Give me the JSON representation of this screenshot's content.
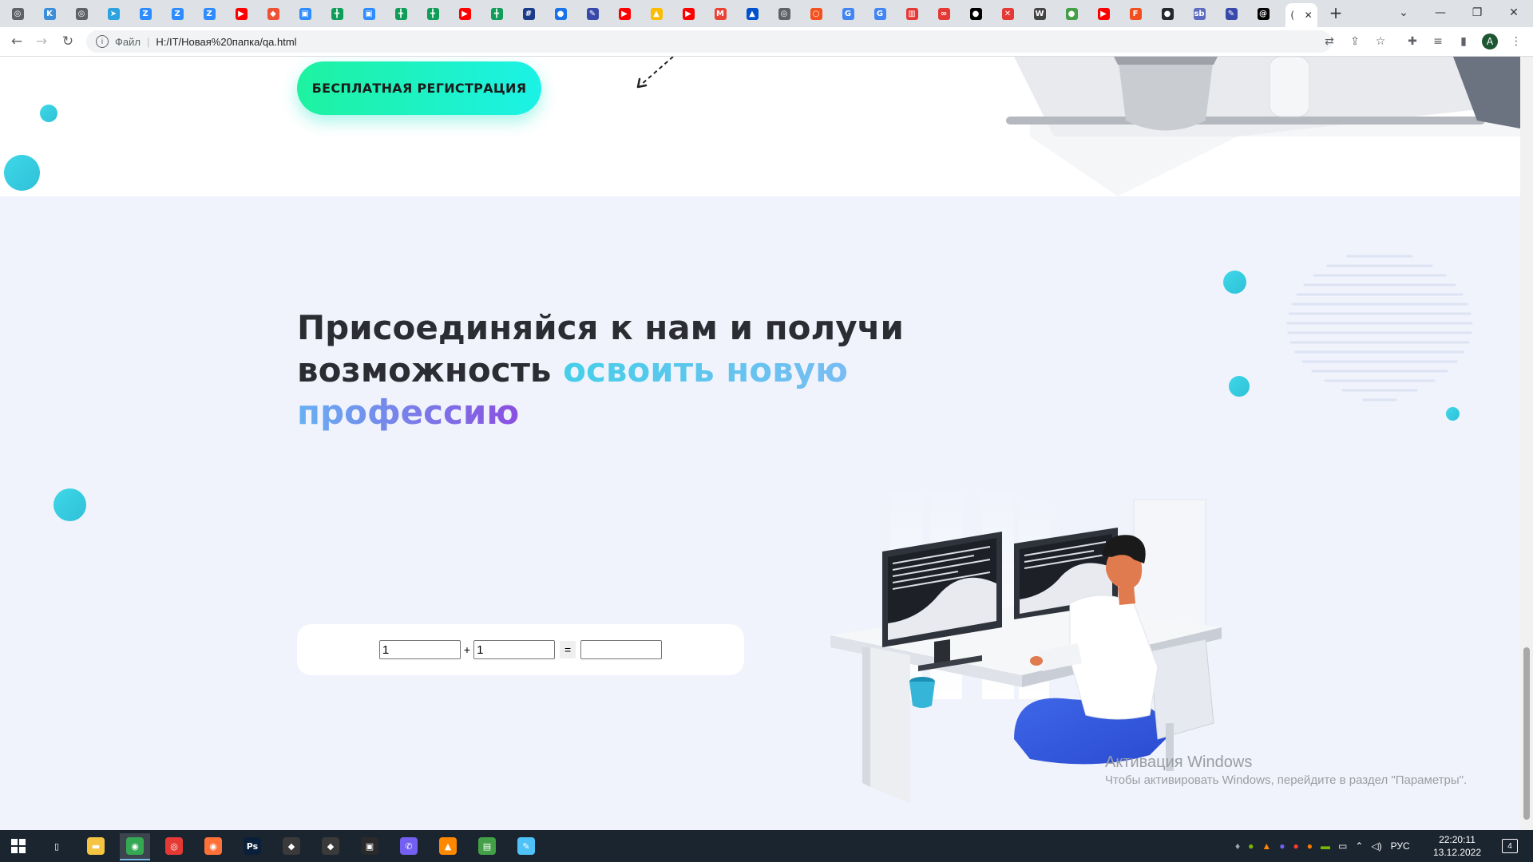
{
  "browser": {
    "tabs": [
      {
        "icon": "chrome-icon",
        "label": "",
        "color": "#5f6368",
        "glyph": "◎"
      },
      {
        "icon": "k-app-icon",
        "label": "",
        "color": "#3b8fd9",
        "glyph": "K"
      },
      {
        "icon": "globe-icon",
        "label": "",
        "color": "#5f6368",
        "glyph": "◎"
      },
      {
        "icon": "telegram-icon",
        "label": "",
        "color": "#2aa3df",
        "glyph": "➤"
      },
      {
        "icon": "zoom-icon",
        "label": "",
        "color": "#2d8cff",
        "glyph": "Z"
      },
      {
        "icon": "zoom-icon",
        "label": "",
        "color": "#2d8cff",
        "glyph": "Z"
      },
      {
        "icon": "zoom-icon",
        "label": "",
        "color": "#2d8cff",
        "glyph": "Z"
      },
      {
        "icon": "youtube-icon",
        "label": "",
        "color": "#ff0000",
        "glyph": "▶"
      },
      {
        "icon": "git-icon",
        "label": "",
        "color": "#f05033",
        "glyph": "◆"
      },
      {
        "icon": "video-meeting-icon",
        "label": "",
        "color": "#2d8cff",
        "glyph": "▣"
      },
      {
        "icon": "sheets-icon",
        "label": "",
        "color": "#0f9d58",
        "glyph": "╋"
      },
      {
        "icon": "video-meeting-icon",
        "label": "",
        "color": "#2d8cff",
        "glyph": "▣"
      },
      {
        "icon": "sheets-icon",
        "label": "",
        "color": "#0f9d58",
        "glyph": "╋"
      },
      {
        "icon": "sheets-icon",
        "label": "",
        "color": "#0f9d58",
        "glyph": "╋"
      },
      {
        "icon": "youtube-icon",
        "label": "",
        "color": "#ff0000",
        "glyph": "▶"
      },
      {
        "icon": "sheets-icon",
        "label": "",
        "color": "#0f9d58",
        "glyph": "╋"
      },
      {
        "icon": "table-icon",
        "label": "",
        "color": "#1a3a8a",
        "glyph": "#"
      },
      {
        "icon": "location-icon",
        "label": "",
        "color": "#1a73e8",
        "glyph": "●"
      },
      {
        "icon": "pen-icon",
        "label": "",
        "color": "#3949ab",
        "glyph": "✎"
      },
      {
        "icon": "youtube-icon",
        "label": "",
        "color": "#ff0000",
        "glyph": "▶"
      },
      {
        "icon": "drive-icon",
        "label": "",
        "color": "#fbbc04",
        "glyph": "▲"
      },
      {
        "icon": "youtube-icon",
        "label": "",
        "color": "#ff0000",
        "glyph": "▶"
      },
      {
        "icon": "gmail-icon",
        "label": "",
        "color": "#ea4335",
        "glyph": "M"
      },
      {
        "icon": "atlassian-icon",
        "label": "",
        "color": "#0052cc",
        "glyph": "▲"
      },
      {
        "icon": "globe-icon",
        "label": "",
        "color": "#5f6368",
        "glyph": "◎"
      },
      {
        "icon": "power-icon",
        "label": "",
        "color": "#f4511e",
        "glyph": "○"
      },
      {
        "icon": "google-icon",
        "label": "",
        "color": "#4285f4",
        "glyph": "G"
      },
      {
        "icon": "google-icon",
        "label": "",
        "color": "#4285f4",
        "glyph": "G"
      },
      {
        "icon": "gift-icon",
        "label": "",
        "color": "#e53935",
        "glyph": "▥"
      },
      {
        "icon": "infinity-icon",
        "label": "",
        "color": "#e53935",
        "glyph": "∞"
      },
      {
        "icon": "medium-icon",
        "label": "",
        "color": "#000000",
        "glyph": "●"
      },
      {
        "icon": "close-box-icon",
        "label": "",
        "color": "#e53935",
        "glyph": "✕"
      },
      {
        "icon": "wikipedia-icon",
        "label": "",
        "color": "#444444",
        "glyph": "W"
      },
      {
        "icon": "green-circle-icon",
        "label": "",
        "color": "#43a047",
        "glyph": "●"
      },
      {
        "icon": "youtube-icon",
        "label": "",
        "color": "#ff0000",
        "glyph": "▶"
      },
      {
        "icon": "figma-icon",
        "label": "",
        "color": "#f24e1e",
        "glyph": "F"
      },
      {
        "icon": "github-icon",
        "label": "",
        "color": "#24292e",
        "glyph": "●"
      },
      {
        "icon": "sb-icon",
        "label": "",
        "color": "#5c6bc0",
        "glyph": "sb"
      },
      {
        "icon": "pen-icon",
        "label": "",
        "color": "#3949ab",
        "glyph": "✎"
      },
      {
        "icon": "threads-icon",
        "label": "",
        "color": "#000000",
        "glyph": "@"
      }
    ],
    "active_tab_label": "(",
    "address": "H:/IT/Новая%20папка/qa.html",
    "site_info_label": "Файл",
    "profile_initial": "A"
  },
  "page": {
    "cta_label": "БЕСПЛАТНАЯ РЕГИСТРАЦИЯ",
    "headline_plain": "Присоединяйся к нам и получи возможность ",
    "headline_accent1": "освоить новую ",
    "headline_accent2": "профессию",
    "calc": {
      "a_value": "1",
      "operator": "+",
      "b_value": "1",
      "equals": "=",
      "result_value": ""
    }
  },
  "watermark": {
    "title": "Активация Windows",
    "subtitle": "Чтобы активировать Windows, перейдите в раздел \"Параметры\"."
  },
  "taskbar": {
    "apps": [
      {
        "icon": "task-view-icon",
        "color": "#1b2530",
        "glyph": "▯"
      },
      {
        "icon": "file-explorer-icon",
        "color": "#f5c542",
        "glyph": "▬"
      },
      {
        "icon": "chrome-icon",
        "color": "#34a853",
        "glyph": "◉"
      },
      {
        "icon": "screen-recorder-icon",
        "color": "#e53935",
        "glyph": "◎"
      },
      {
        "icon": "firefox-icon",
        "color": "#ff7139",
        "glyph": "◉"
      },
      {
        "icon": "photoshop-icon",
        "color": "#0a1f3a",
        "glyph": "Ps"
      },
      {
        "icon": "game-tank-icon",
        "color": "#3a3a3a",
        "glyph": "◆"
      },
      {
        "icon": "game-knight-icon",
        "color": "#3a3a3a",
        "glyph": "◆"
      },
      {
        "icon": "game-dark-icon",
        "color": "#2a2a2a",
        "glyph": "▣"
      },
      {
        "icon": "viber-icon",
        "color": "#7360f2",
        "glyph": "✆"
      },
      {
        "icon": "vlc-icon",
        "color": "#ff8800",
        "glyph": "▲"
      },
      {
        "icon": "notepad-icon",
        "color": "#43a047",
        "glyph": "▤"
      },
      {
        "icon": "paint-icon",
        "color": "#4fc3f7",
        "glyph": "✎"
      }
    ],
    "tray_lang": "РУС",
    "time": "22:20:11",
    "date": "13.12.2022",
    "notifications_count": "4"
  }
}
